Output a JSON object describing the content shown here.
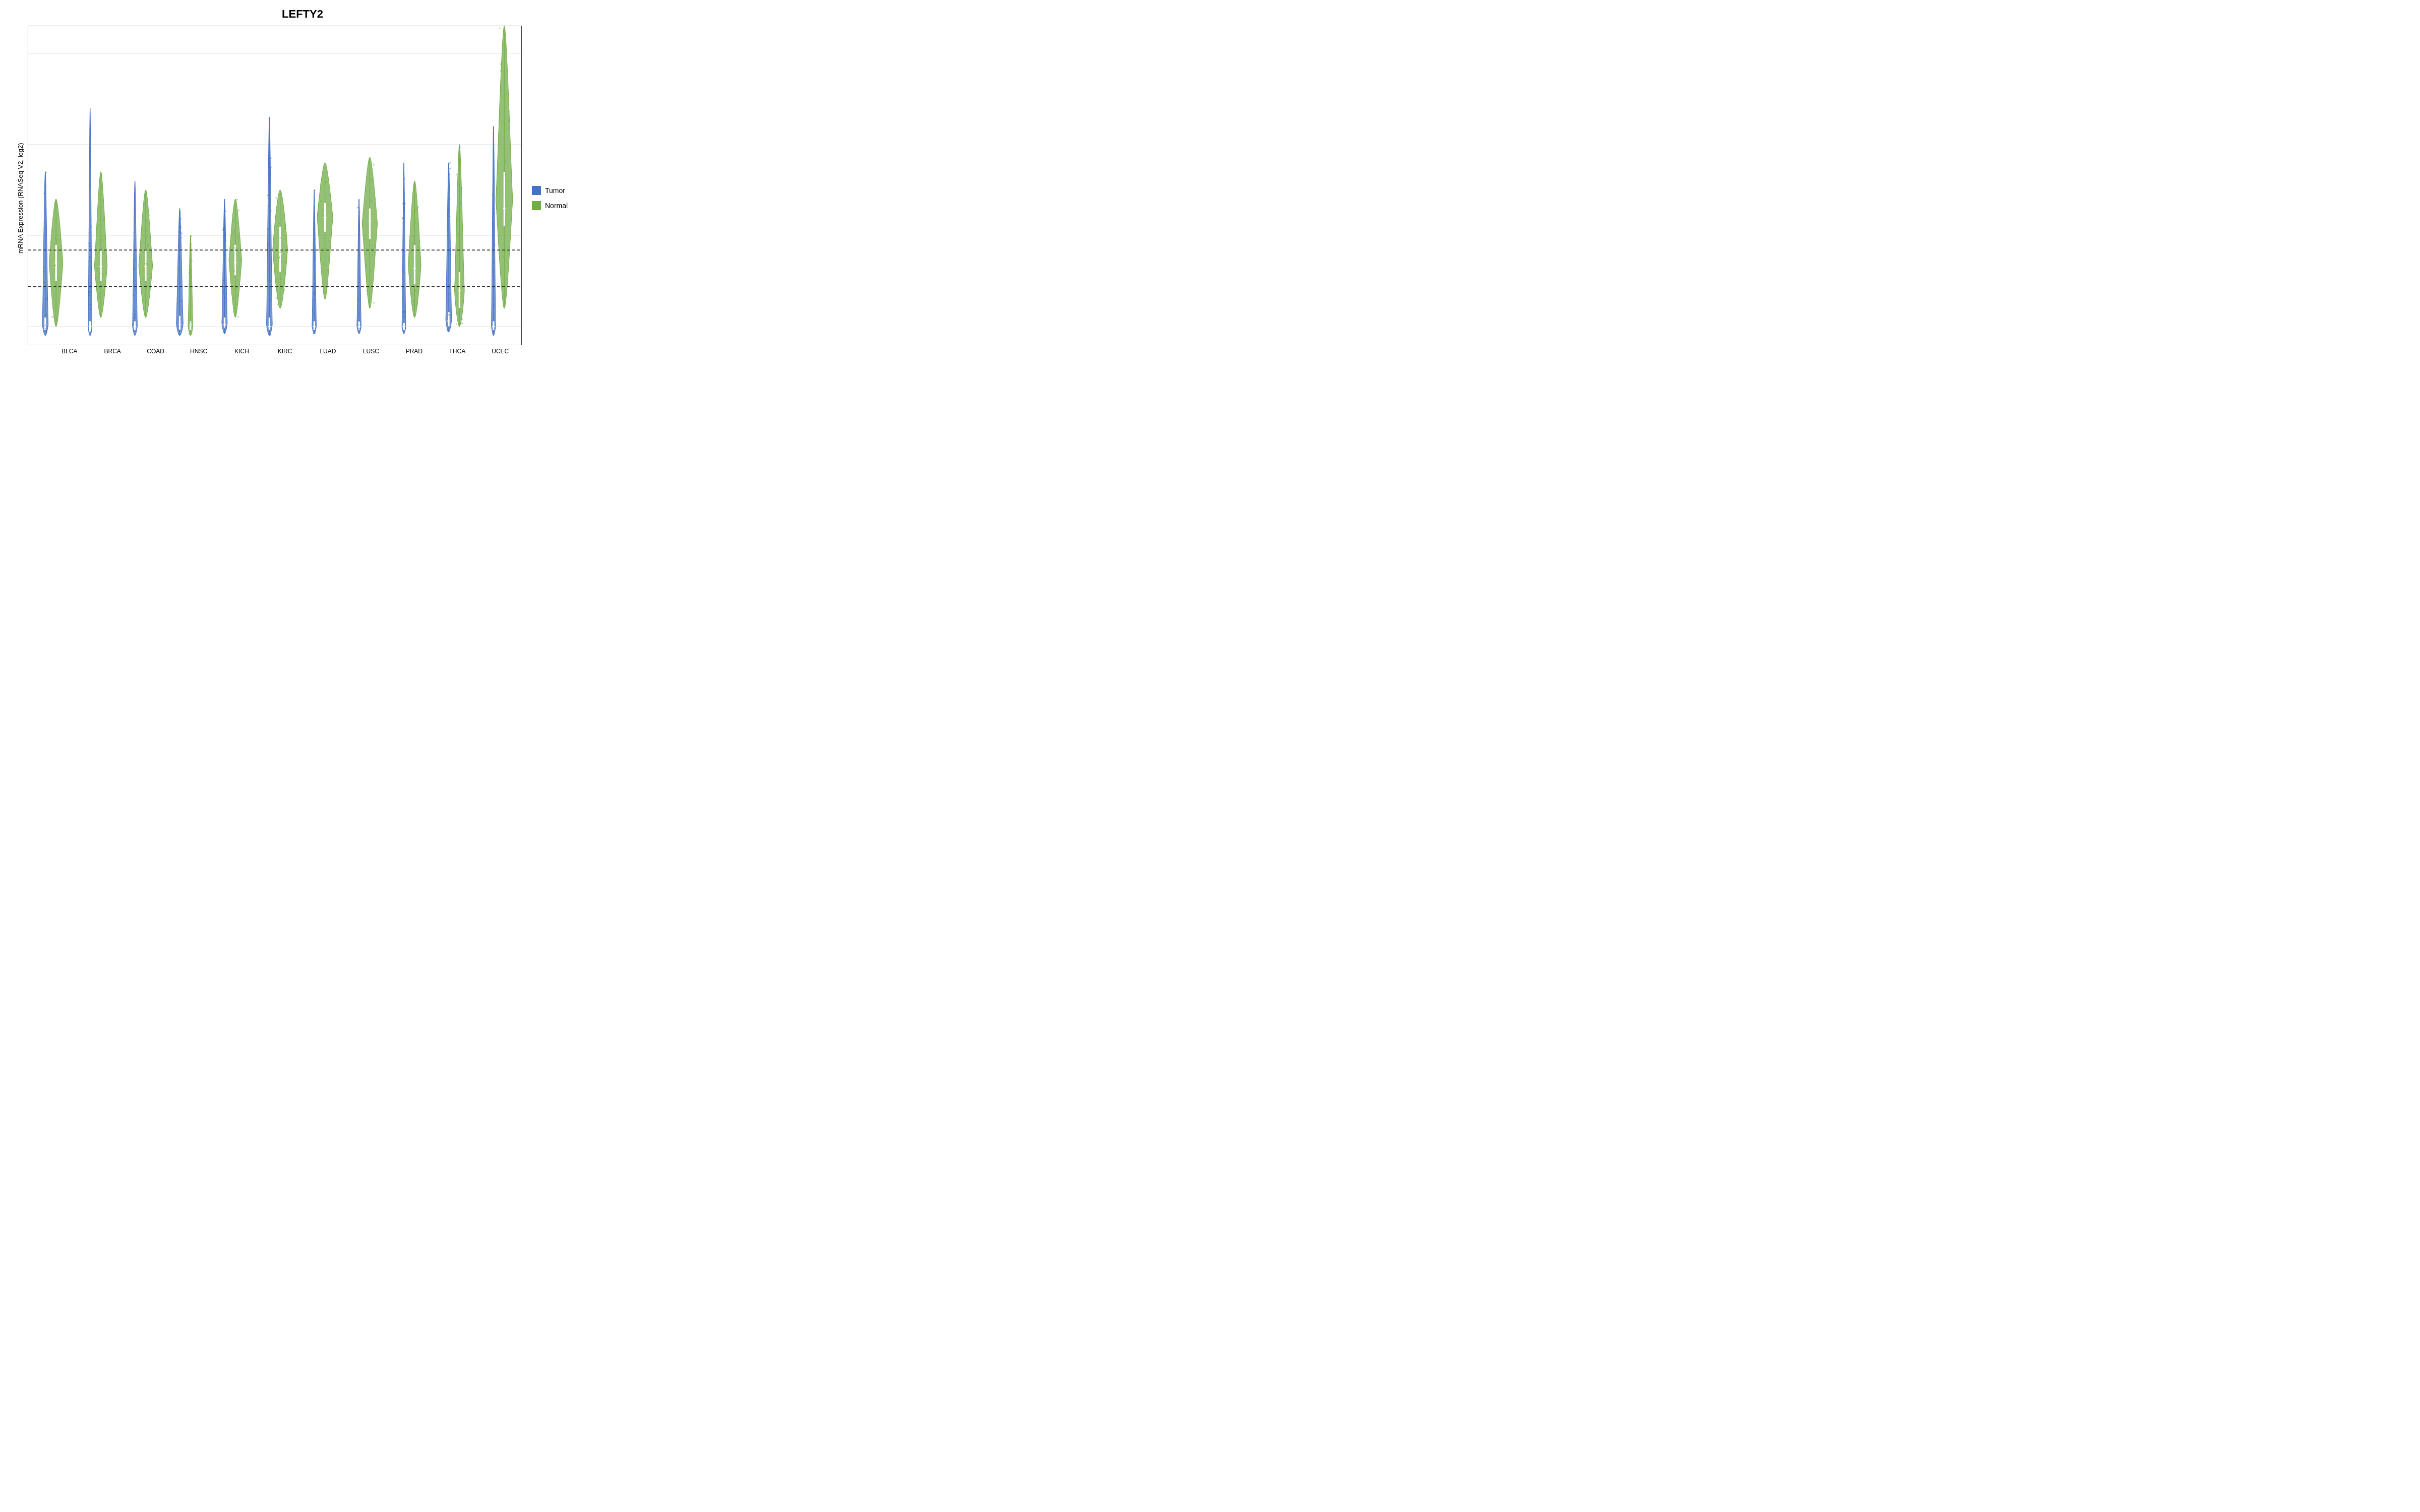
{
  "title": "LEFTY2",
  "yAxis": {
    "label": "mRNA Expression (RNASeq V2, log2)",
    "ticks": [
      0,
      5,
      10,
      15
    ],
    "min": -1,
    "max": 16.5
  },
  "xAxis": {
    "labels": [
      "BLCA",
      "BRCA",
      "COAD",
      "HNSC",
      "KICH",
      "KIRC",
      "LUAD",
      "LUSC",
      "PRAD",
      "THCA",
      "UCEC"
    ]
  },
  "legend": {
    "items": [
      {
        "label": "Tumor",
        "color": "#4472C4"
      },
      {
        "label": "Normal",
        "color": "#70AD47"
      }
    ]
  },
  "dottedLines": [
    2.2,
    4.2
  ],
  "violins": {
    "tumor_color": "#4472C4",
    "normal_color": "#70AD47"
  }
}
